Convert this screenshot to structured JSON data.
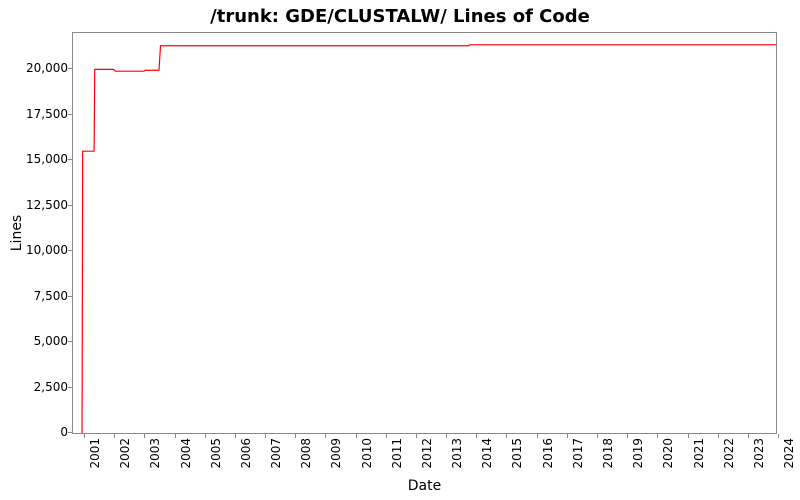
{
  "chart_data": {
    "type": "line",
    "title": "/trunk: GDE/CLUSTALW/ Lines of Code",
    "xlabel": "Date",
    "ylabel": "Lines",
    "xlim": [
      2000.6,
      2023.9
    ],
    "ylim": [
      0,
      22000
    ],
    "y_ticks": [
      0,
      2500,
      5000,
      7500,
      10000,
      12500,
      15000,
      17500,
      20000
    ],
    "y_tick_labels": [
      "0",
      "2,500",
      "5,000",
      "7,500",
      "10,000",
      "12,500",
      "15,000",
      "17,500",
      "20,000"
    ],
    "x_ticks": [
      2001,
      2002,
      2003,
      2004,
      2005,
      2006,
      2007,
      2008,
      2009,
      2010,
      2011,
      2012,
      2013,
      2014,
      2015,
      2016,
      2017,
      2018,
      2019,
      2020,
      2021,
      2022,
      2023,
      2024
    ],
    "line_color": "#ff0000",
    "series": [
      {
        "name": "Lines of Code",
        "points": [
          {
            "x": 2000.9,
            "y": 0
          },
          {
            "x": 2000.92,
            "y": 15500
          },
          {
            "x": 2001.3,
            "y": 15500
          },
          {
            "x": 2001.32,
            "y": 20000
          },
          {
            "x": 2001.95,
            "y": 20000
          },
          {
            "x": 2002.0,
            "y": 19900
          },
          {
            "x": 2002.95,
            "y": 19900
          },
          {
            "x": 2003.0,
            "y": 19950
          },
          {
            "x": 2003.45,
            "y": 19950
          },
          {
            "x": 2003.5,
            "y": 21300
          },
          {
            "x": 2013.7,
            "y": 21300
          },
          {
            "x": 2013.75,
            "y": 21350
          },
          {
            "x": 2023.9,
            "y": 21350
          }
        ]
      }
    ]
  }
}
